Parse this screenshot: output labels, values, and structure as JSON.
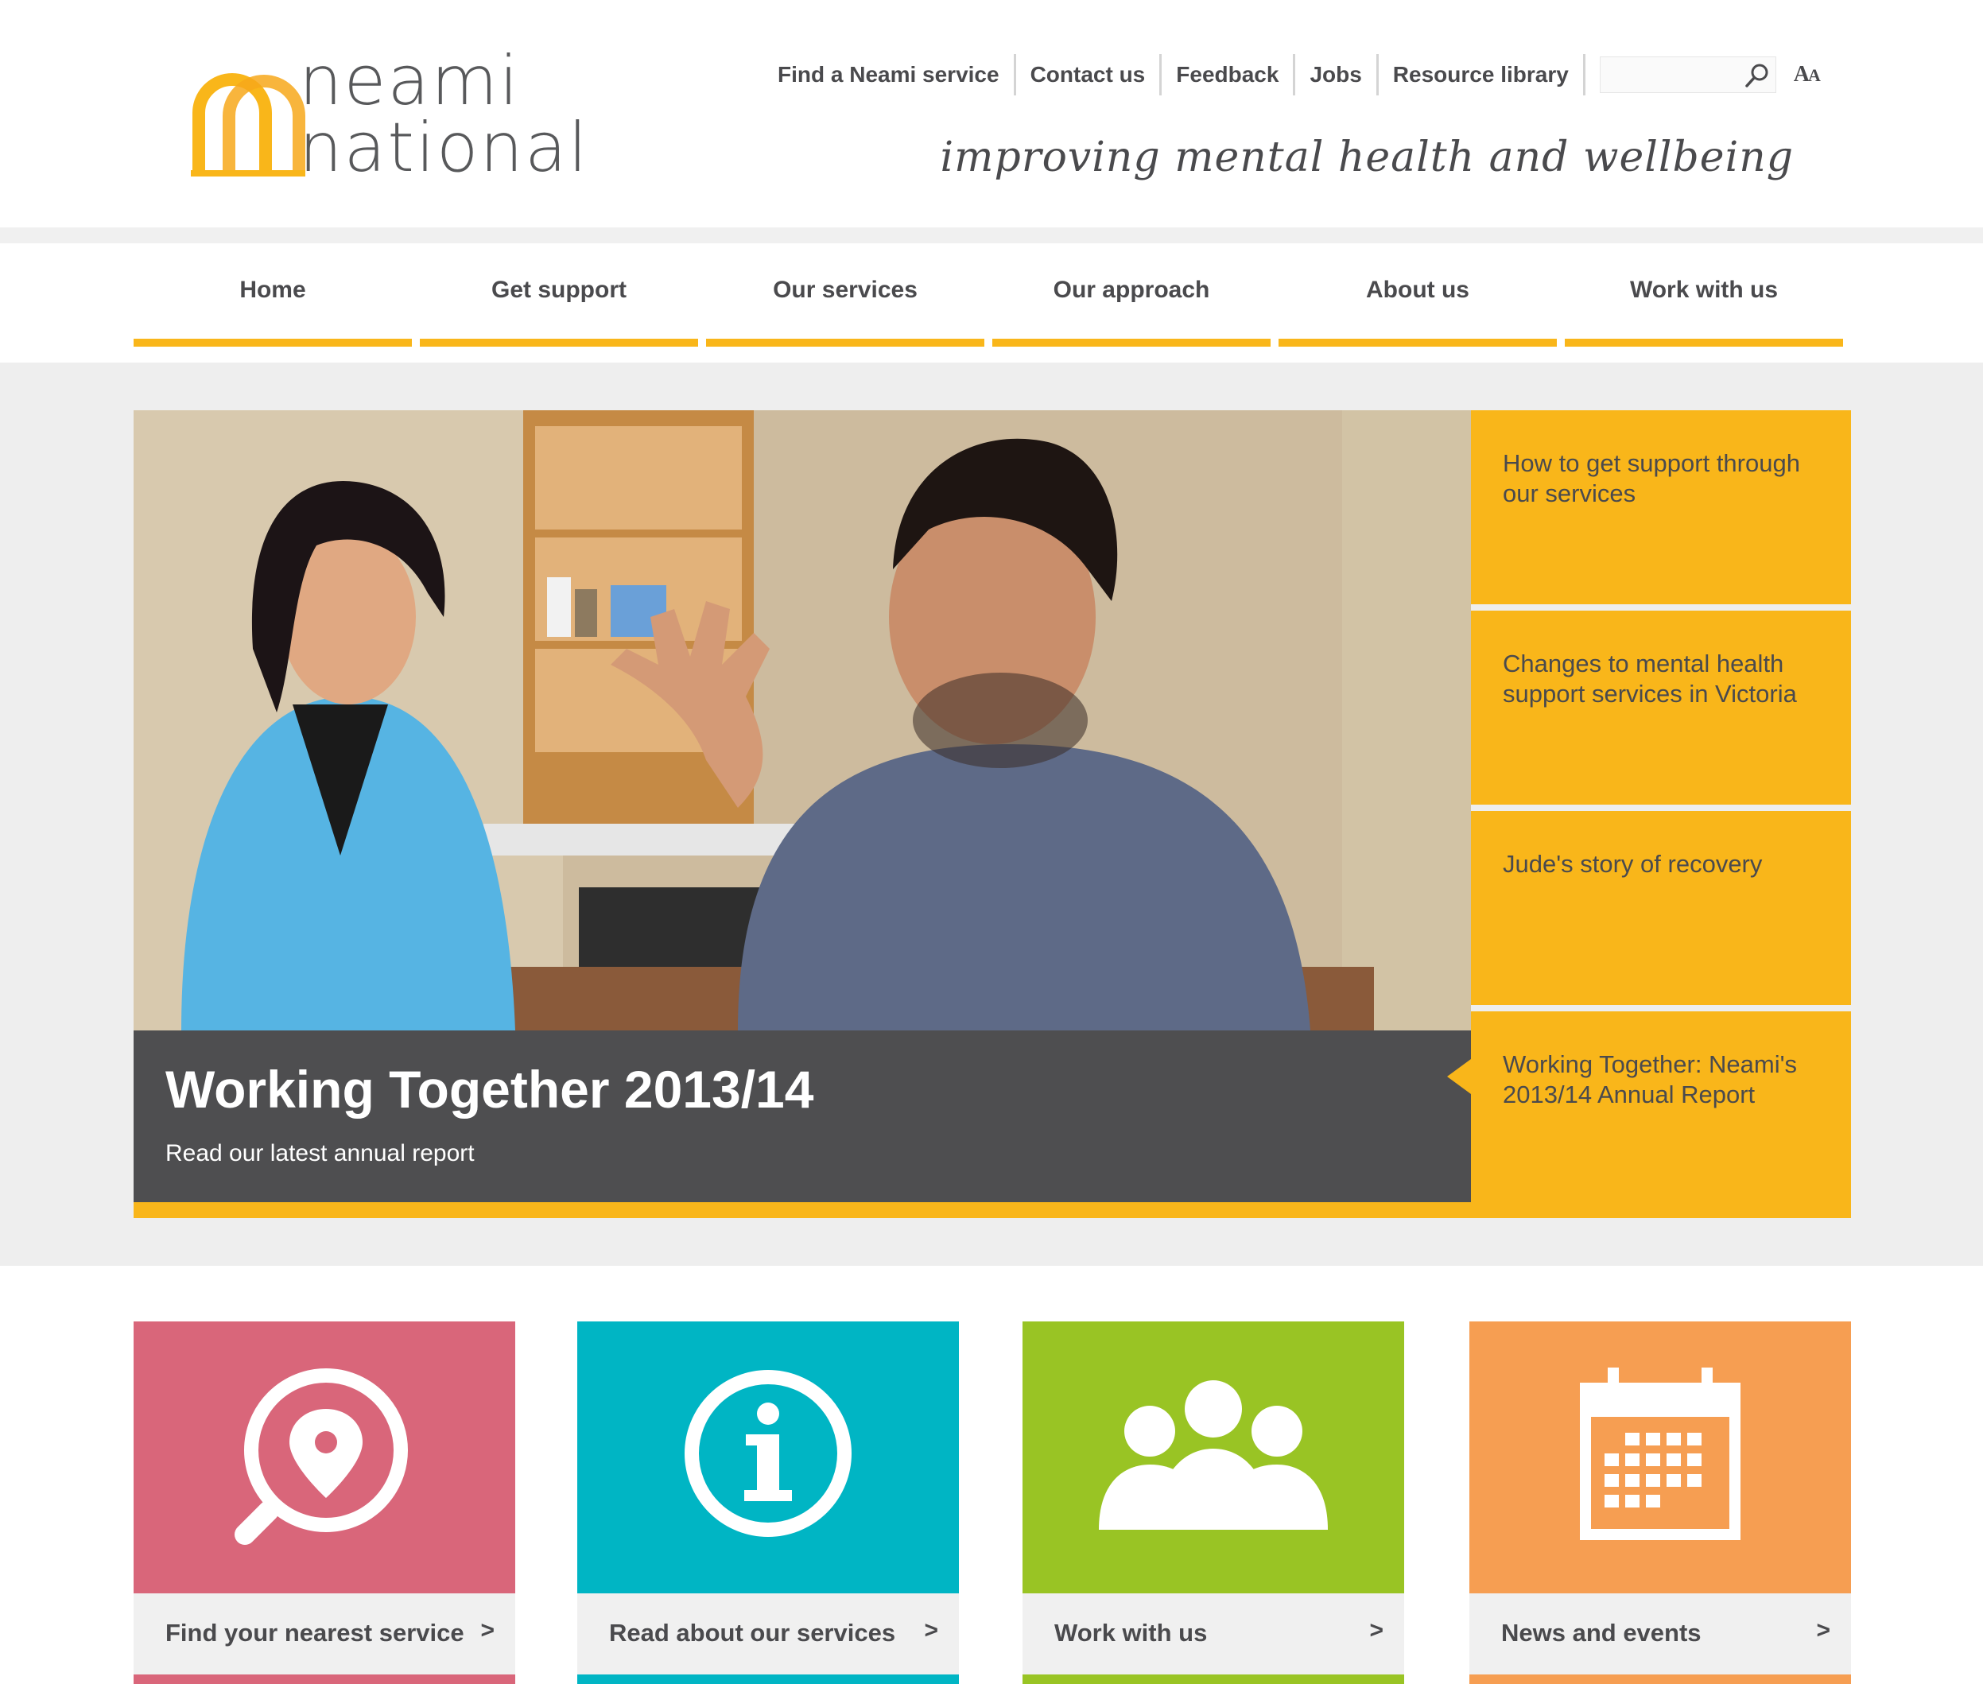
{
  "header": {
    "logo_line1": "neami",
    "logo_line2": "national",
    "utility_links": [
      "Find a Neami service",
      "Contact us",
      "Feedback",
      "Jobs",
      "Resource library"
    ],
    "search_placeholder": "",
    "font_size_toggle_big": "A",
    "font_size_toggle_small": "A",
    "tagline": "improving mental health and wellbeing"
  },
  "main_nav": [
    "Home",
    "Get support",
    "Our services",
    "Our approach",
    "About us",
    "Work with us"
  ],
  "hero": {
    "title": "Working Together 2013/14",
    "subtitle": "Read our latest annual report",
    "tabs": [
      "How to get support through our services",
      "Changes to mental health support services in Victoria",
      "Jude's story of recovery",
      "Working Together: Neami's 2013/14 Annual Report"
    ],
    "active_tab": 3
  },
  "tiles": [
    {
      "label": "Find your nearest service",
      "arrow": ">",
      "color": "#d9667a",
      "icon": "location-search-icon"
    },
    {
      "label": "Read about our services",
      "arrow": ">",
      "color": "#00b5c4",
      "icon": "info-icon"
    },
    {
      "label": "Work with us",
      "arrow": ">",
      "color": "#99c424",
      "icon": "people-group-icon"
    },
    {
      "label": "News and events",
      "arrow": ">",
      "color": "#f69e52",
      "icon": "calendar-icon"
    }
  ],
  "colors": {
    "accent_yellow": "#f9b61a",
    "text_dark": "#4a4a4d",
    "caption_bg": "#4e4e50"
  }
}
